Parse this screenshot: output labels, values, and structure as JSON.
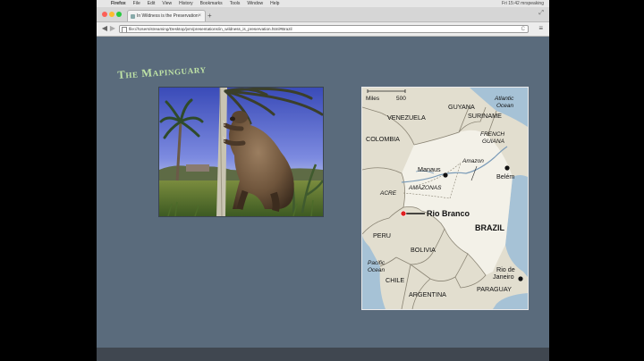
{
  "menubar": {
    "apple": "",
    "items": [
      "Firefox",
      "File",
      "Edit",
      "View",
      "History",
      "Bookmarks",
      "Tools",
      "Window",
      "Help"
    ],
    "status": "Fri 15:42   mrspeaking"
  },
  "tab": {
    "title": "In Wildness is the Preservation",
    "close": "×",
    "new_tab": "+"
  },
  "nav": {
    "url": "file:///Users/streaming/Desktop/jvm/presentations/in_wildness_is_preservation.html#Brazil",
    "reload": "C",
    "menu": "≡"
  },
  "slide": {
    "title": "The Mapinguary"
  },
  "map": {
    "scale_miles": "Miles",
    "scale_value": "500",
    "labels": {
      "venezuela": "VENEZUELA",
      "guyana": "GUYANA",
      "suriname": "SURINAME",
      "french_guiana_1": "FRENCH",
      "french_guiana_2": "GUIANA",
      "atlantic_1": "Atlantic",
      "atlantic_2": "Ocean",
      "colombia": "COLOMBIA",
      "manaus": "Manaus",
      "amazon": "Amazon",
      "belem": "Belém",
      "amazonas": "AMAZONAS",
      "acre": "ACRE",
      "rio_branco": "Rio Branco",
      "brazil": "BRAZIL",
      "peru": "PERU",
      "bolivia": "BOLIVIA",
      "pacific_1": "Pacific",
      "pacific_2": "Ocean",
      "rio_1": "Rio de",
      "rio_2": "Janeiro",
      "chile": "CHILE",
      "argentina": "ARGENTINA",
      "paraguay": "PARAGUAY"
    }
  },
  "colors": {
    "slide_bg": "#5a6b7c",
    "title": "#bfe3a6",
    "ocean": "#a6c2d6",
    "land": "#e2decf",
    "brazil_land": "#f3f1e8",
    "rio_branco_marker": "#e02020"
  }
}
